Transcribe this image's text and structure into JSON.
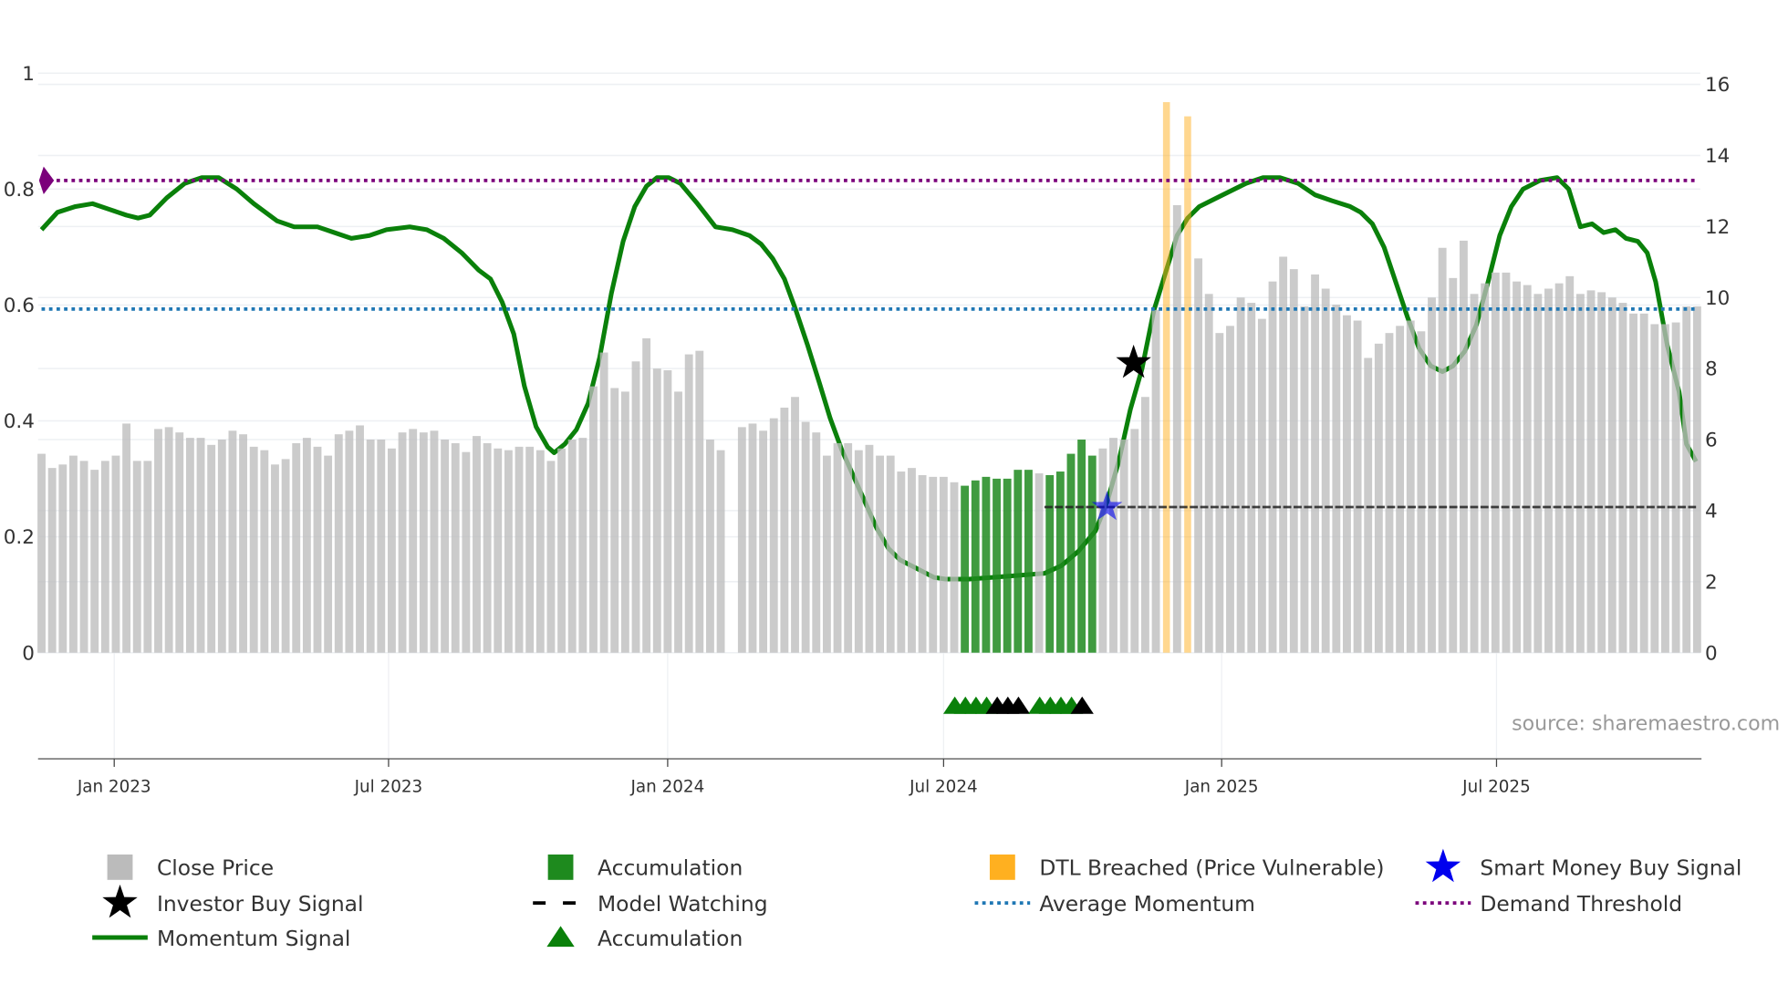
{
  "chart_data": {
    "type": "bar",
    "title": "",
    "x_unit": "week index (weekly bars)",
    "xlim": [
      0,
      156.5
    ],
    "ylim_left": [
      0,
      1
    ],
    "ylim_right": [
      0,
      16
    ],
    "grid": true,
    "left_ticks": [
      {
        "v": 0,
        "label": "0"
      },
      {
        "v": 0.2,
        "label": "0.2"
      },
      {
        "v": 0.4,
        "label": "0.4"
      },
      {
        "v": 0.6,
        "label": "0.6"
      },
      {
        "v": 0.8,
        "label": "0.8"
      },
      {
        "v": 1,
        "label": "1"
      }
    ],
    "right_ticks": [
      {
        "v": 0,
        "label": "0"
      },
      {
        "v": 2,
        "label": "2"
      },
      {
        "v": 4,
        "label": "4"
      },
      {
        "v": 6,
        "label": "6"
      },
      {
        "v": 8,
        "label": "8"
      },
      {
        "v": 10,
        "label": "10"
      },
      {
        "v": 12,
        "label": "12"
      },
      {
        "v": 14,
        "label": "14"
      },
      {
        "v": 16,
        "label": "16"
      }
    ],
    "x_ticks": [
      {
        "v": 6.85,
        "label": "Jan 2023"
      },
      {
        "v": 32.7,
        "label": "Jul 2023"
      },
      {
        "v": 59,
        "label": "Jan 2024"
      },
      {
        "v": 85,
        "label": "Jul 2024"
      },
      {
        "v": 111.2,
        "label": "Jan 2025"
      },
      {
        "v": 137.1,
        "label": "Jul 2025"
      }
    ],
    "close_price": [
      5.6,
      5.2,
      5.3,
      5.55,
      5.4,
      5.15,
      5.4,
      5.55,
      6.45,
      5.4,
      5.4,
      6.3,
      6.35,
      6.2,
      6.05,
      6.05,
      5.85,
      6.0,
      6.25,
      6.15,
      5.8,
      5.7,
      5.3,
      5.45,
      5.9,
      6.05,
      5.8,
      5.55,
      6.15,
      6.25,
      6.4,
      6.0,
      6.0,
      5.75,
      6.2,
      6.3,
      6.2,
      6.25,
      6.0,
      5.9,
      5.65,
      6.1,
      5.9,
      5.75,
      5.7,
      5.8,
      5.8,
      5.7,
      5.4,
      5.75,
      6.0,
      6.05,
      7.5,
      8.45,
      7.45,
      7.35,
      8.2,
      8.85,
      8.0,
      7.95,
      7.35,
      8.4,
      8.5,
      6.0,
      5.7,
      null,
      6.35,
      6.45,
      6.25,
      6.6,
      6.9,
      7.2,
      6.5,
      6.2,
      5.55,
      5.9,
      5.9,
      5.7,
      5.85,
      5.55,
      5.55,
      5.1,
      5.2,
      5.0,
      4.95,
      4.95,
      4.8,
      4.7,
      4.85,
      4.95,
      4.9,
      4.9,
      5.15,
      5.15,
      5.05,
      5.0,
      5.1,
      5.6,
      6.0,
      5.55,
      5.75,
      6.05,
      6.0,
      6.3,
      7.2,
      9.65,
      15.5,
      12.6,
      15.1,
      11.1,
      10.1,
      9.0,
      9.2,
      10.0,
      9.85,
      9.4,
      10.45,
      11.15,
      10.8,
      9.75,
      10.65,
      10.25,
      9.8,
      9.5,
      9.35,
      8.3,
      8.7,
      9.0,
      9.2,
      9.35,
      9.05,
      10.0,
      11.4,
      10.55,
      11.6,
      10.1,
      10.4,
      10.7,
      10.7,
      10.45,
      10.35,
      10.1,
      10.25,
      10.4,
      10.6,
      10.1,
      10.2,
      10.15,
      10.0,
      9.85,
      9.55,
      9.55,
      9.25,
      9.25,
      9.3,
      9.75,
      9.75
    ],
    "accumulation_bar_indices": [
      87,
      88,
      89,
      90,
      91,
      92,
      93,
      95,
      96,
      97,
      98,
      99
    ],
    "dtl_breached_bar_indices": [
      106,
      108
    ],
    "momentum_signal": [
      [
        0,
        0.73
      ],
      [
        1.5,
        0.76
      ],
      [
        3.2,
        0.77
      ],
      [
        4.8,
        0.775
      ],
      [
        6.4,
        0.765
      ],
      [
        8.0,
        0.755
      ],
      [
        9.1,
        0.75
      ],
      [
        10.2,
        0.755
      ],
      [
        11.8,
        0.785
      ],
      [
        13.5,
        0.81
      ],
      [
        15.1,
        0.82
      ],
      [
        16.7,
        0.82
      ],
      [
        18.4,
        0.8
      ],
      [
        20,
        0.775
      ],
      [
        22.2,
        0.745
      ],
      [
        23.8,
        0.735
      ],
      [
        26,
        0.735
      ],
      [
        27.6,
        0.725
      ],
      [
        29.2,
        0.715
      ],
      [
        30.9,
        0.72
      ],
      [
        32.5,
        0.73
      ],
      [
        34.7,
        0.735
      ],
      [
        36.3,
        0.73
      ],
      [
        37.9,
        0.715
      ],
      [
        39.6,
        0.69
      ],
      [
        41.2,
        0.66
      ],
      [
        42.3,
        0.645
      ],
      [
        43.4,
        0.605
      ],
      [
        44.5,
        0.55
      ],
      [
        45.5,
        0.46
      ],
      [
        46.6,
        0.39
      ],
      [
        47.7,
        0.355
      ],
      [
        48.3,
        0.345
      ],
      [
        49.3,
        0.36
      ],
      [
        50.4,
        0.385
      ],
      [
        51.5,
        0.43
      ],
      [
        52.6,
        0.51
      ],
      [
        53.7,
        0.62
      ],
      [
        54.8,
        0.71
      ],
      [
        55.9,
        0.77
      ],
      [
        57,
        0.805
      ],
      [
        58,
        0.82
      ],
      [
        59.1,
        0.82
      ],
      [
        60.2,
        0.81
      ],
      [
        61.8,
        0.775
      ],
      [
        63.5,
        0.735
      ],
      [
        65.1,
        0.73
      ],
      [
        66.7,
        0.72
      ],
      [
        67.8,
        0.705
      ],
      [
        68.9,
        0.68
      ],
      [
        70,
        0.645
      ],
      [
        71.1,
        0.59
      ],
      [
        72.2,
        0.53
      ],
      [
        73.3,
        0.465
      ],
      [
        74.3,
        0.405
      ],
      [
        75.4,
        0.35
      ],
      [
        76.5,
        0.305
      ],
      [
        77.6,
        0.26
      ],
      [
        78.7,
        0.215
      ],
      [
        79.8,
        0.18
      ],
      [
        80.9,
        0.16
      ],
      [
        82.5,
        0.145
      ],
      [
        84.1,
        0.13
      ],
      [
        85.2,
        0.127
      ],
      [
        87.4,
        0.127
      ],
      [
        89.6,
        0.13
      ],
      [
        91.7,
        0.133
      ],
      [
        94.5,
        0.137
      ],
      [
        96.1,
        0.15
      ],
      [
        97.7,
        0.175
      ],
      [
        99.3,
        0.21
      ],
      [
        100.4,
        0.26
      ],
      [
        101.5,
        0.33
      ],
      [
        102.6,
        0.42
      ],
      [
        103.7,
        0.49
      ],
      [
        104.8,
        0.59
      ],
      [
        105.9,
        0.655
      ],
      [
        107,
        0.72
      ],
      [
        108,
        0.75
      ],
      [
        109.1,
        0.77
      ],
      [
        111.3,
        0.79
      ],
      [
        113.5,
        0.81
      ],
      [
        115.1,
        0.82
      ],
      [
        116.7,
        0.82
      ],
      [
        118.4,
        0.81
      ],
      [
        120,
        0.79
      ],
      [
        121.6,
        0.78
      ],
      [
        123.3,
        0.77
      ],
      [
        124.3,
        0.76
      ],
      [
        125.4,
        0.74
      ],
      [
        126.5,
        0.7
      ],
      [
        127.6,
        0.64
      ],
      [
        128.7,
        0.58
      ],
      [
        129.8,
        0.525
      ],
      [
        130.9,
        0.495
      ],
      [
        132,
        0.485
      ],
      [
        133,
        0.495
      ],
      [
        134.1,
        0.52
      ],
      [
        135.2,
        0.565
      ],
      [
        136.3,
        0.64
      ],
      [
        137.4,
        0.72
      ],
      [
        138.5,
        0.77
      ],
      [
        139.6,
        0.8
      ],
      [
        141.2,
        0.815
      ],
      [
        142.8,
        0.82
      ],
      [
        143.9,
        0.8
      ],
      [
        145,
        0.735
      ],
      [
        146.1,
        0.74
      ],
      [
        147.2,
        0.725
      ],
      [
        148.3,
        0.73
      ],
      [
        149.3,
        0.715
      ],
      [
        150.4,
        0.71
      ],
      [
        151.3,
        0.69
      ],
      [
        152.1,
        0.64
      ],
      [
        153.2,
        0.53
      ],
      [
        154.3,
        0.45
      ],
      [
        155,
        0.36
      ],
      [
        155.9,
        0.33
      ]
    ],
    "demand_threshold": 0.815,
    "average_momentum": 0.593,
    "demand_marker_index": 0.2,
    "model_watching": {
      "from_index": 94.5,
      "to_index": 155.9,
      "price": 4.1
    },
    "investor_buy_signal": {
      "index": 102.9,
      "momentum": 0.5
    },
    "smart_money_buy_signal": {
      "index": 100.4,
      "price": 4.1
    },
    "accumulation_triangles": [
      {
        "index": 86,
        "color": "green"
      },
      {
        "index": 87,
        "color": "green"
      },
      {
        "index": 88,
        "color": "green"
      },
      {
        "index": 89,
        "color": "green"
      },
      {
        "index": 90,
        "color": "black"
      },
      {
        "index": 91,
        "color": "black"
      },
      {
        "index": 92,
        "color": "black"
      },
      {
        "index": 94,
        "color": "green"
      },
      {
        "index": 95,
        "color": "green"
      },
      {
        "index": 96,
        "color": "green"
      },
      {
        "index": 97,
        "color": "green"
      },
      {
        "index": 98,
        "color": "black"
      }
    ],
    "colors": {
      "close": "#bdbdbd",
      "accumulation": "#1e8a1e",
      "dtl": "#ffb020",
      "momentum": "#0a800a",
      "avg": "#1f77b4",
      "demand": "#7b007b",
      "smart": "#0000ee",
      "investor": "#000000"
    },
    "legend": [
      {
        "label": "Close Price",
        "icon": "gray-square"
      },
      {
        "label": "Accumulation",
        "icon": "green-square"
      },
      {
        "label": "DTL Breached (Price Vulnerable)",
        "icon": "orange-square"
      },
      {
        "label": "Smart Money Buy Signal",
        "icon": "blue-star"
      },
      {
        "label": "Investor Buy Signal",
        "icon": "black-star"
      },
      {
        "label": "Model Watching",
        "icon": "black-dash"
      },
      {
        "label": "Average Momentum",
        "icon": "blue-dotted"
      },
      {
        "label": "Demand Threshold",
        "icon": "purple-dotted"
      },
      {
        "label": "Momentum Signal",
        "icon": "green-line"
      },
      {
        "label": "Accumulation",
        "icon": "green-triangle"
      }
    ],
    "legend_placement": "bottom",
    "source": "source: sharemaestro.com"
  }
}
